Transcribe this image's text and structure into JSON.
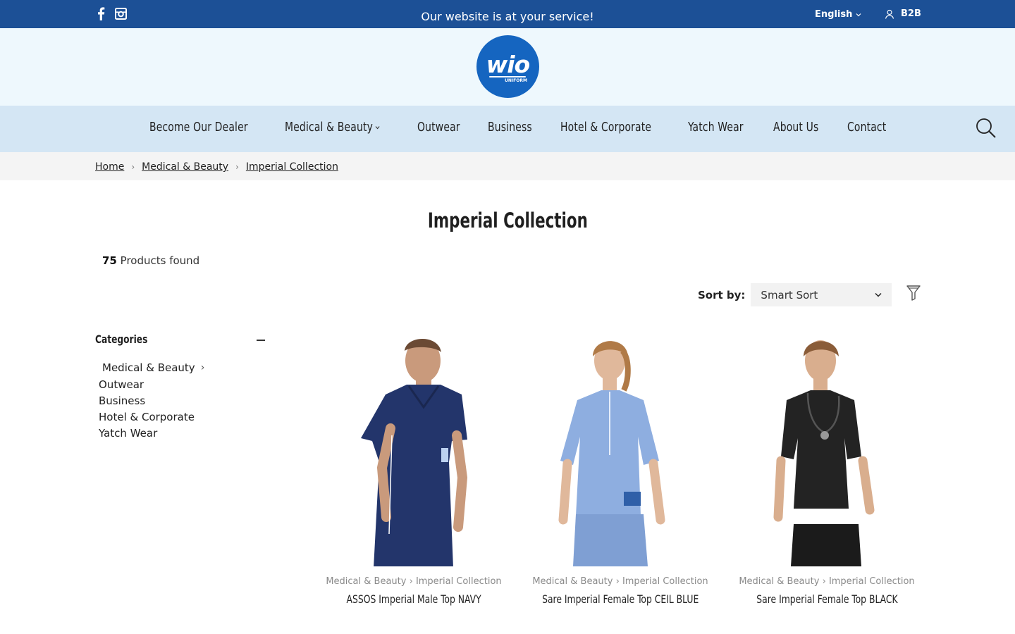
{
  "topbar": {
    "tagline": "Our website is at your service!",
    "language": "English",
    "b2b": "B2B",
    "social_icons": [
      "facebook-icon",
      "instagram-icon"
    ]
  },
  "logo": {
    "text": "wio",
    "subtext": "UNIFORM"
  },
  "nav": {
    "items": [
      {
        "label": "Become Our Dealer"
      },
      {
        "label": "Medical & Beauty",
        "has_dropdown": true
      },
      {
        "label": "Outwear"
      },
      {
        "label": "Business"
      },
      {
        "label": "Hotel & Corporate"
      },
      {
        "label": "Yatch Wear"
      },
      {
        "label": "About Us"
      },
      {
        "label": "Contact"
      }
    ]
  },
  "breadcrumb": [
    "Home",
    "Medical & Beauty",
    "Imperial Collection"
  ],
  "page": {
    "title": "Imperial Collection",
    "products_count": "75",
    "products_found_label": "Products found",
    "sort_label": "Sort by:",
    "sort_value": "Smart Sort"
  },
  "categories": {
    "heading": "Categories",
    "items": [
      "Medical & Beauty",
      "Outwear",
      "Business",
      "Hotel & Corporate",
      "Yatch Wear"
    ]
  },
  "products": [
    {
      "category": "Medical & Beauty",
      "collection": "Imperial Collection",
      "name": "ASSOS Imperial Male Top NAVY",
      "color": "#23356b"
    },
    {
      "category": "Medical & Beauty",
      "collection": "Imperial Collection",
      "name": "Sare Imperial Female Top CEIL BLUE",
      "color": "#7f9fd3"
    },
    {
      "category": "Medical & Beauty",
      "collection": "Imperial Collection",
      "name": "Sare Imperial Female Top BLACK",
      "color": "#232323"
    }
  ],
  "colors": {
    "topbar": "#1c5096",
    "logo_circle": "#1565c0",
    "nav_bg": "#d4e6f4",
    "logo_band_bg": "#eef8fd"
  }
}
